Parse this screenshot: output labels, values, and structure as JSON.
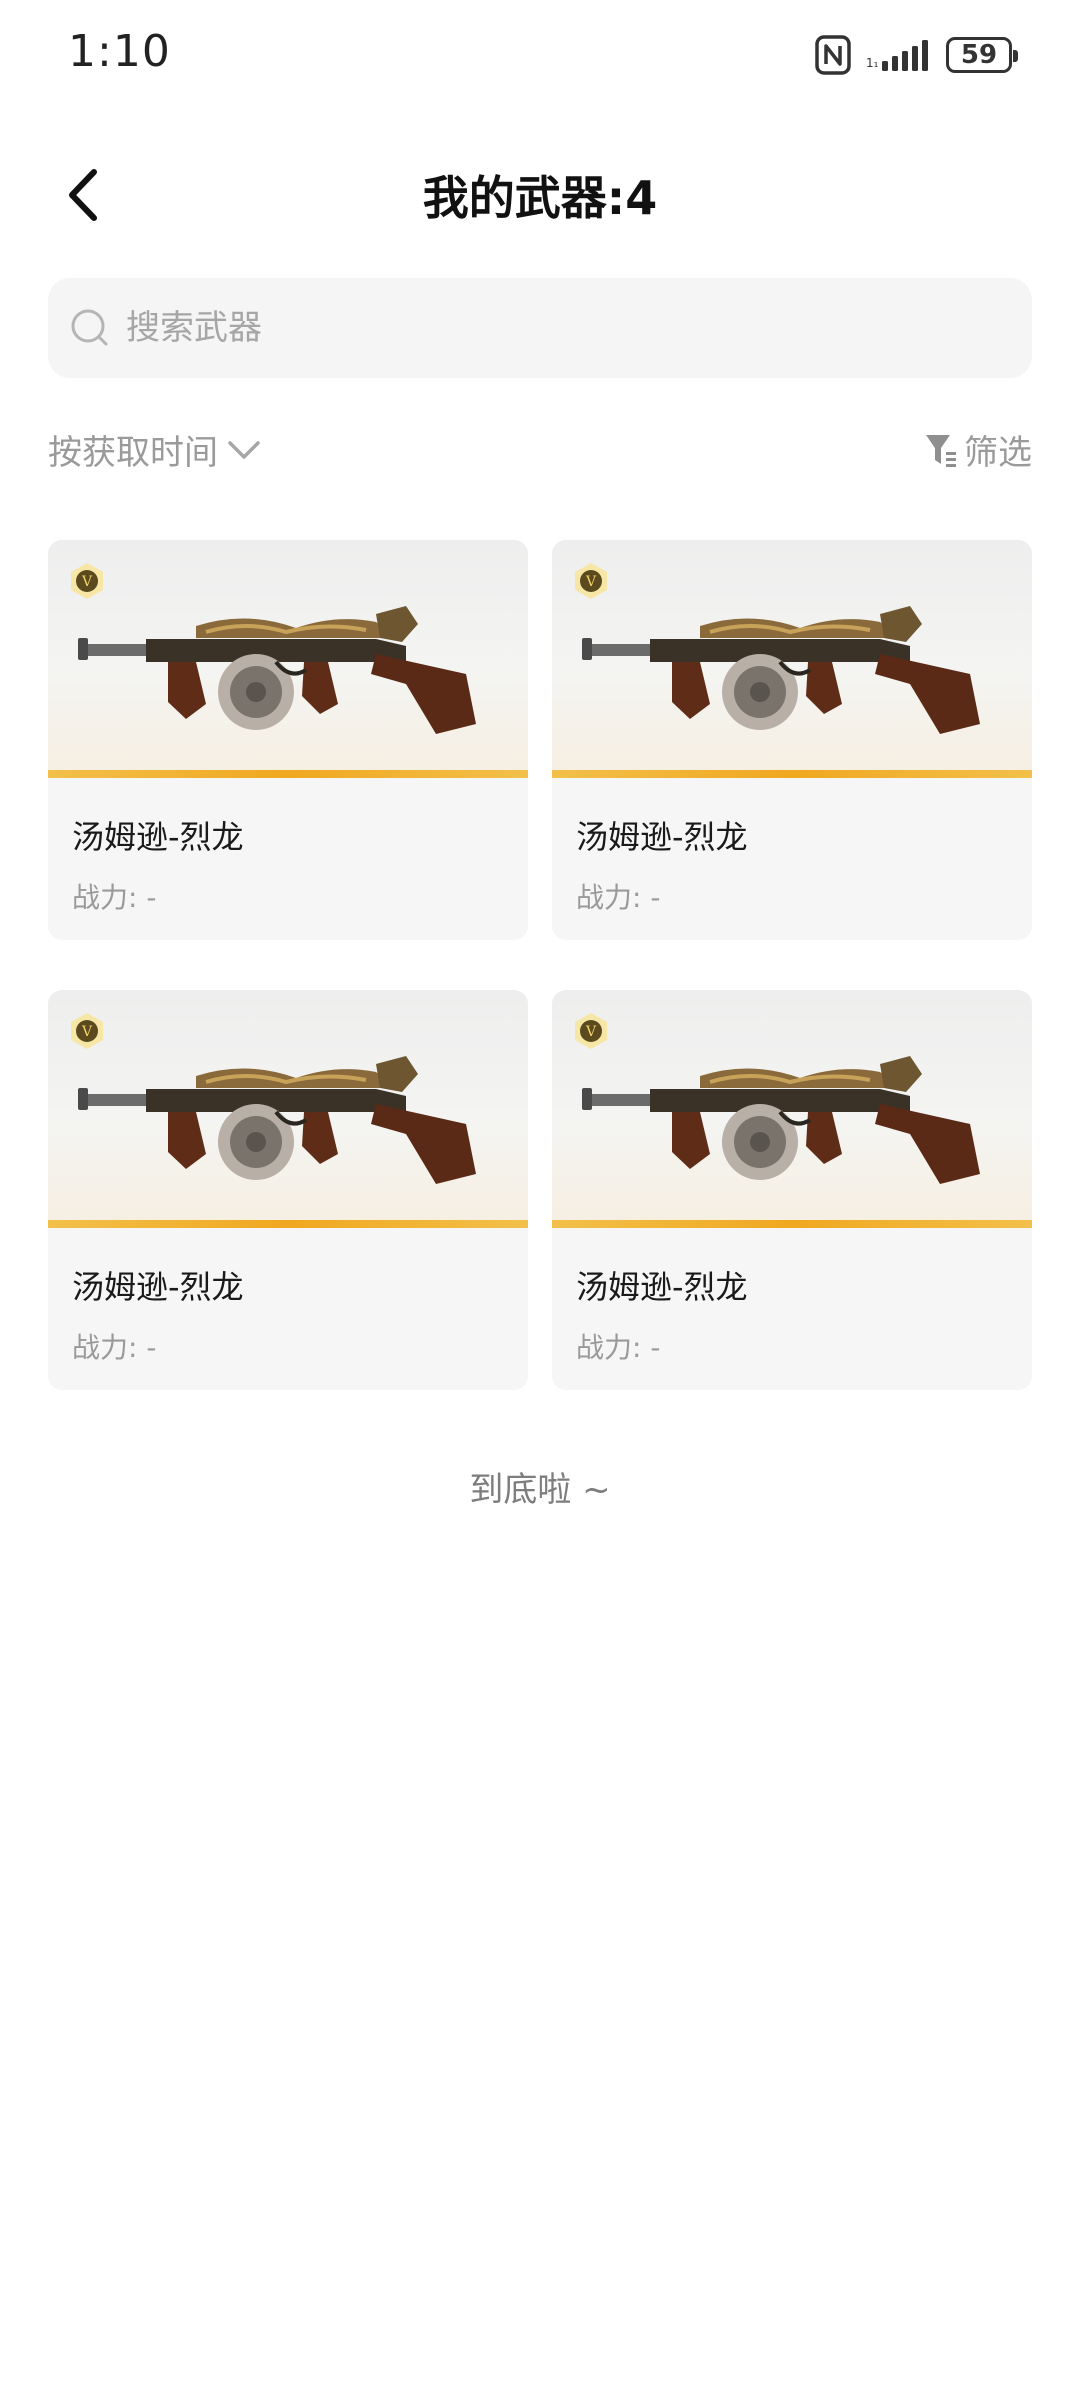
{
  "status_bar": {
    "time": "1:10",
    "battery": "59"
  },
  "header": {
    "title": "我的武器:4"
  },
  "search": {
    "placeholder": "搜索武器"
  },
  "toolbar": {
    "sort_label": "按获取时间",
    "filter_label": "筛选"
  },
  "weapons": [
    {
      "name": "汤姆逊-烈龙",
      "power": "战力: -",
      "badge": "V"
    },
    {
      "name": "汤姆逊-烈龙",
      "power": "战力: -",
      "badge": "V"
    },
    {
      "name": "汤姆逊-烈龙",
      "power": "战力: -",
      "badge": "V"
    },
    {
      "name": "汤姆逊-烈龙",
      "power": "战力: -",
      "badge": "V"
    }
  ],
  "footer": {
    "end_text": "到底啦 ~"
  },
  "colors": {
    "accent_stripe": "#f0a820",
    "card_bg": "#f6f6f6",
    "muted_text": "#9a9a9a"
  }
}
